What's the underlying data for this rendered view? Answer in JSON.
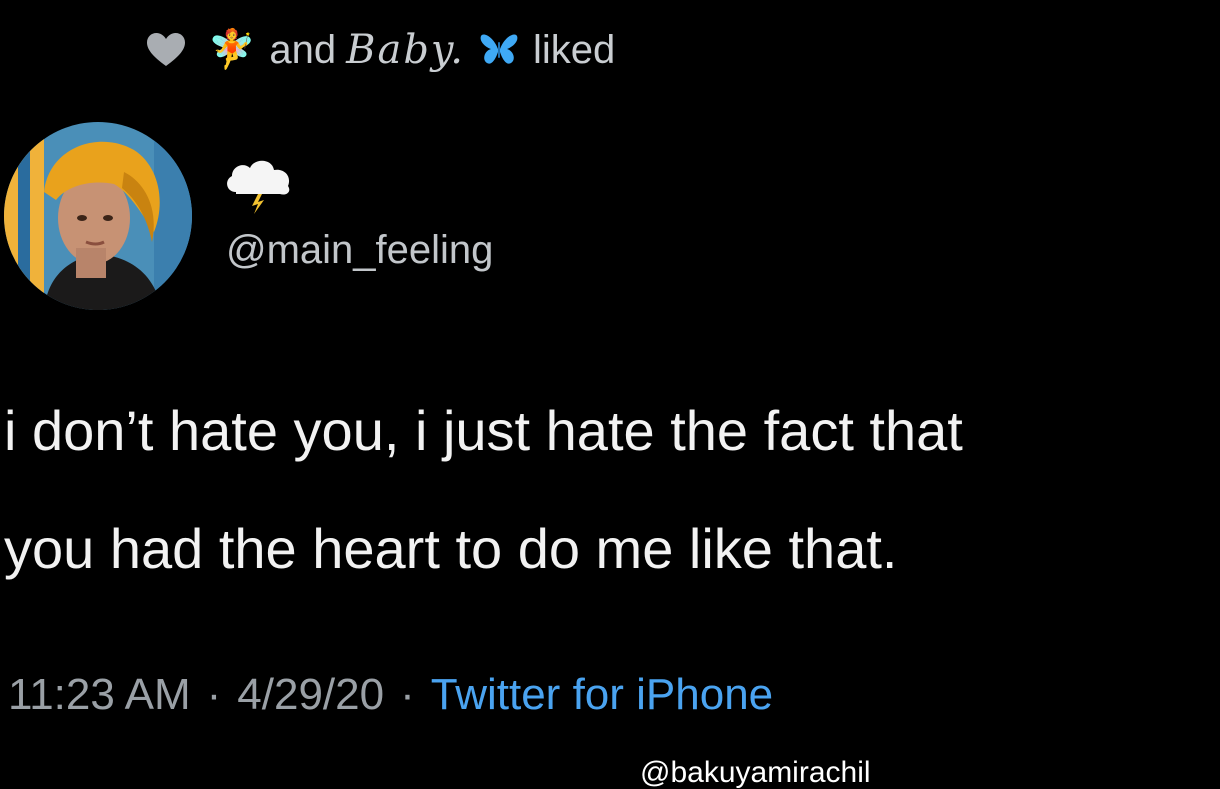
{
  "social_context": {
    "icon": "heart-icon",
    "fairy_emoji": "🧚",
    "and_text": "and",
    "name": "Baby.",
    "butterfly_icon": "butterfly-icon",
    "action_text": "liked"
  },
  "author": {
    "avatar": "profile-photo",
    "display_name_icon": "cloud-lightning-icon",
    "handle": "@main_feeling"
  },
  "tweet": {
    "lines": [
      "i don’t hate you, i just hate the fact that",
      "you had the heart to do me like that."
    ]
  },
  "meta": {
    "time": "11:23 AM",
    "separator": "·",
    "date": "4/29/20",
    "source": "Twitter for iPhone"
  },
  "watermark": {
    "text": "@bakuyamirachil"
  },
  "colors": {
    "background": "#000000",
    "text": "#f2f2f2",
    "muted": "#9aa0a6",
    "link": "#4aa3f0",
    "butterfly": "#3fa9f5"
  }
}
